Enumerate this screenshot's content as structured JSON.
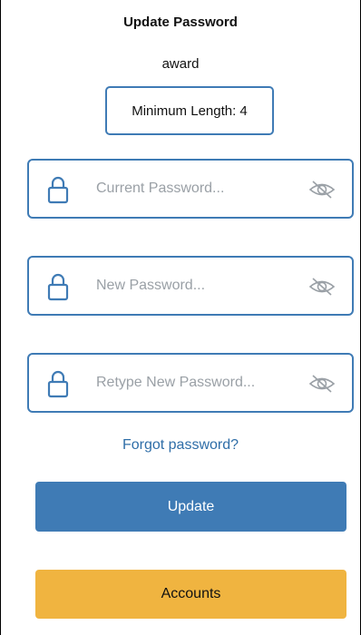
{
  "header": {
    "title": "Update Password",
    "subtitle": "award"
  },
  "rules": {
    "min_length_label": "Minimum Length: 4"
  },
  "fields": [
    {
      "placeholder": "Current Password...",
      "value": "",
      "icon": "lock-icon",
      "toggle_icon": "eye-slash-icon"
    },
    {
      "placeholder": "New Password...",
      "value": "",
      "icon": "lock-icon",
      "toggle_icon": "eye-slash-icon"
    },
    {
      "placeholder": "Retype New Password...",
      "value": "",
      "icon": "lock-icon",
      "toggle_icon": "eye-slash-icon"
    }
  ],
  "links": {
    "forgot_password": "Forgot password?"
  },
  "buttons": {
    "update_label": "Update",
    "accounts_label": "Accounts"
  },
  "colors": {
    "primary": "#3f7bb5",
    "accent": "#f0b440",
    "link": "#2f6ea8"
  }
}
